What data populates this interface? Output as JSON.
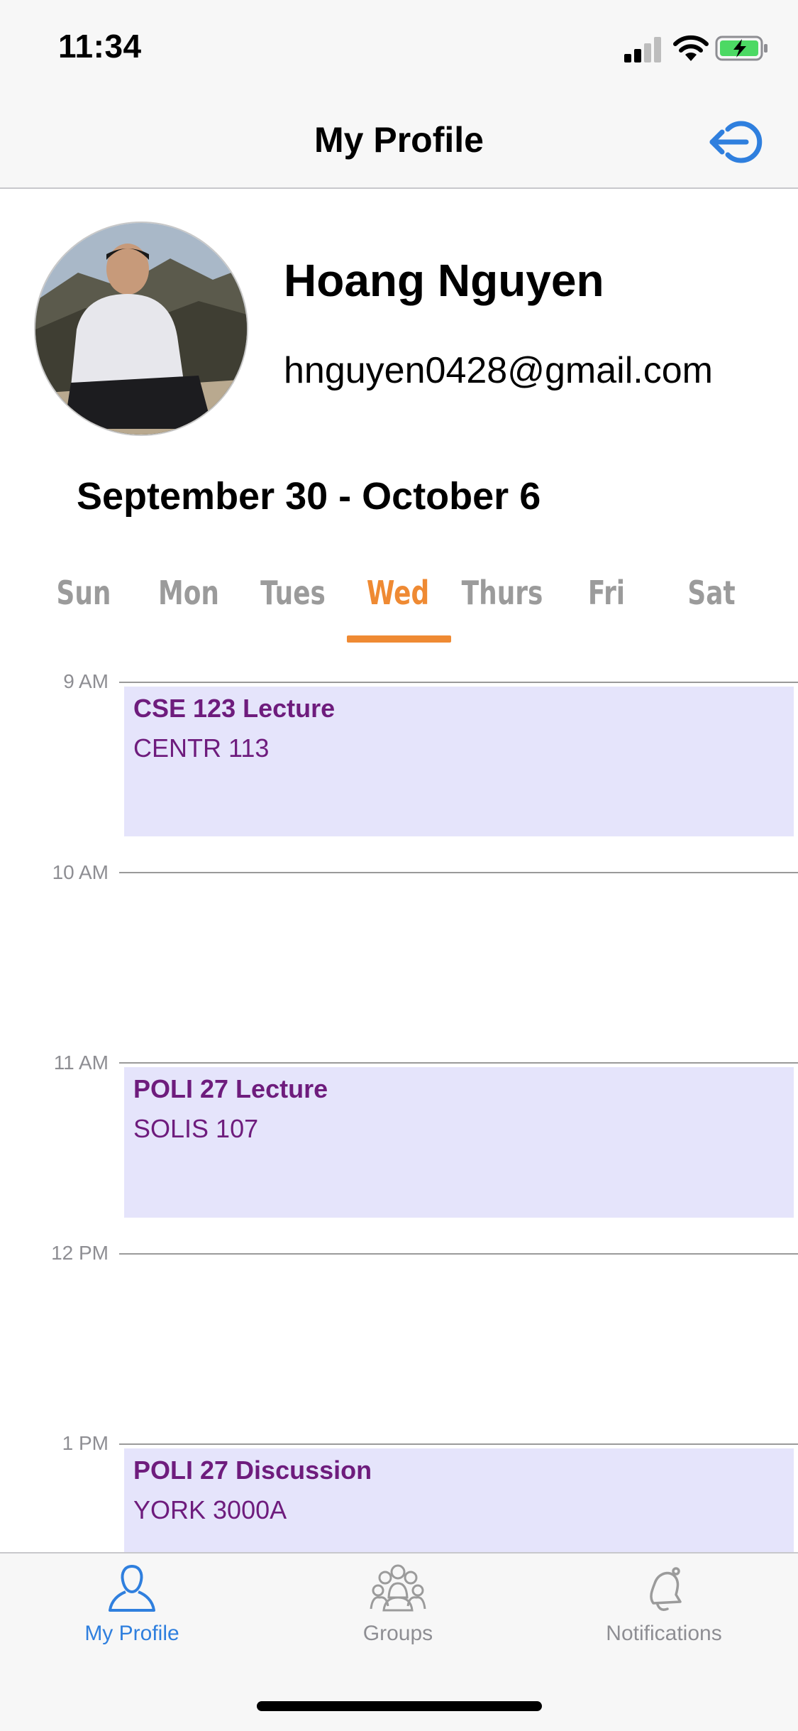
{
  "status_bar": {
    "time": "11:34"
  },
  "nav": {
    "title": "My Profile",
    "logout_icon": "logout-icon"
  },
  "profile": {
    "name": "Hoang Nguyen",
    "email": "hnguyen0428@gmail.com"
  },
  "week": {
    "range": "September 30 - October 6"
  },
  "days": [
    {
      "label": "Sun",
      "active": false
    },
    {
      "label": "Mon",
      "active": false
    },
    {
      "label": "Tues",
      "active": false
    },
    {
      "label": "Wed",
      "active": true
    },
    {
      "label": "Thurs",
      "active": false
    },
    {
      "label": "Fri",
      "active": false
    },
    {
      "label": "Sat",
      "active": false
    }
  ],
  "schedule": {
    "hours": [
      "9 AM",
      "10 AM",
      "11 AM",
      "12 PM",
      "1 PM"
    ],
    "events": [
      {
        "title": "CSE 123 Lecture",
        "location": "CENTR 113"
      },
      {
        "title": "POLI 27 Lecture",
        "location": "SOLIS 107"
      },
      {
        "title": "POLI 27 Discussion",
        "location": "YORK 3000A"
      }
    ]
  },
  "tabs": [
    {
      "label": "My Profile",
      "icon": "person-icon",
      "active": true
    },
    {
      "label": "Groups",
      "icon": "group-icon",
      "active": false
    },
    {
      "label": "Notifications",
      "icon": "bell-icon",
      "active": false
    }
  ],
  "colors": {
    "accent_orange": "#ef8a33",
    "accent_blue": "#2f7fde",
    "event_bg": "#e5e4fb",
    "event_text": "#6e1c7d"
  }
}
